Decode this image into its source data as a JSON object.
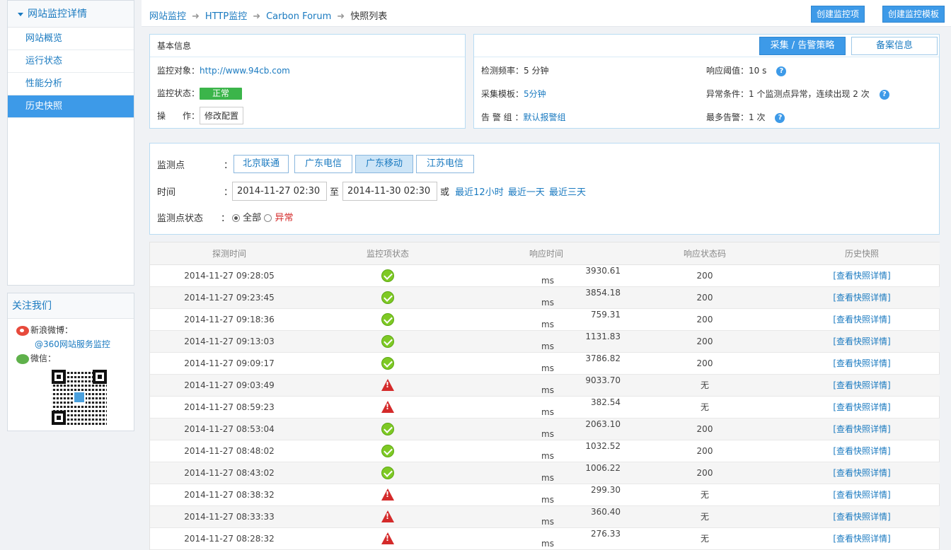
{
  "sidebar": {
    "title": "网站监控详情",
    "items": [
      {
        "label": "网站概览",
        "active": false
      },
      {
        "label": "运行状态",
        "active": false
      },
      {
        "label": "性能分析",
        "active": false
      },
      {
        "label": "历史快照",
        "active": true
      }
    ]
  },
  "follow": {
    "title": "关注我们",
    "weibo_label": "新浪微博：",
    "weibo_handle": "@360网站服务监控",
    "wechat_label": "微信："
  },
  "breadcrumb": {
    "items": [
      "网站监控",
      "HTTP监控",
      "Carbon Forum"
    ],
    "current": "快照列表"
  },
  "top_buttons": {
    "create_item": "创建监控项",
    "create_template": "创建监控模板"
  },
  "basic_info": {
    "title": "基本信息",
    "target_label": "监控对象：",
    "target_value": "http://www.94cb.com",
    "status_label": "监控状态：",
    "status_value": "正常",
    "op_label": "操　　作：",
    "op_button": "修改配置"
  },
  "policy": {
    "tab_active": "采集 / 告警策略",
    "tab_other": "备案信息",
    "freq_label": "检测频率：",
    "freq_value": "5 分钟",
    "template_label": "采集模板：",
    "template_value": "5分钟",
    "group_label": "告 警 组 ：",
    "group_value": "默认报警组",
    "threshold_label": "响应阈值：",
    "threshold_value": "10 s",
    "cond_label": "异常条件：",
    "cond_value": "1 个监测点异常，连续出现 2 次",
    "max_label": "最多告警：",
    "max_value": "1 次",
    "help_glyph": "?"
  },
  "filter": {
    "points_label": "监测点",
    "colon": "：",
    "points": [
      "北京联通",
      "广东电信",
      "广东移动",
      "江苏电信"
    ],
    "active_point": "广东移动",
    "time_label": "时间",
    "start": "2014-11-27 02:30",
    "to": "至",
    "end": "2014-11-30 02:30",
    "or": "或",
    "quick": [
      "最近12小时",
      "最近一天",
      "最近三天"
    ],
    "state_label": "监测点状态",
    "state_all": "全部",
    "state_abn": "异常"
  },
  "table": {
    "headers": [
      "探测时间",
      "监控项状态",
      "响应时间",
      "响应状态码",
      "历史快照"
    ],
    "unit": "ms",
    "link": "[查看快照详情]",
    "rows": [
      {
        "time": "2014-11-27 09:28:05",
        "status": "ok",
        "resp": "3930.61",
        "code": "200"
      },
      {
        "time": "2014-11-27 09:23:45",
        "status": "ok",
        "resp": "3854.18",
        "code": "200"
      },
      {
        "time": "2014-11-27 09:18:36",
        "status": "ok",
        "resp": "759.31",
        "code": "200"
      },
      {
        "time": "2014-11-27 09:13:03",
        "status": "ok",
        "resp": "1131.83",
        "code": "200"
      },
      {
        "time": "2014-11-27 09:09:17",
        "status": "ok",
        "resp": "3786.82",
        "code": "200"
      },
      {
        "time": "2014-11-27 09:03:49",
        "status": "warn",
        "resp": "9033.70",
        "code": "无"
      },
      {
        "time": "2014-11-27 08:59:23",
        "status": "warn",
        "resp": "382.54",
        "code": "无"
      },
      {
        "time": "2014-11-27 08:53:04",
        "status": "ok",
        "resp": "2063.10",
        "code": "200"
      },
      {
        "time": "2014-11-27 08:48:02",
        "status": "ok",
        "resp": "1032.52",
        "code": "200"
      },
      {
        "time": "2014-11-27 08:43:02",
        "status": "ok",
        "resp": "1006.22",
        "code": "200"
      },
      {
        "time": "2014-11-27 08:38:32",
        "status": "warn",
        "resp": "299.30",
        "code": "无"
      },
      {
        "time": "2014-11-27 08:33:33",
        "status": "warn",
        "resp": "360.40",
        "code": "无"
      },
      {
        "time": "2014-11-27 08:28:32",
        "status": "warn",
        "resp": "276.33",
        "code": "无"
      }
    ]
  },
  "colors": {
    "accent": "#3d9ae8",
    "link": "#1a7ac0",
    "ok": "#3bb54a",
    "alert": "#d42a2a"
  }
}
